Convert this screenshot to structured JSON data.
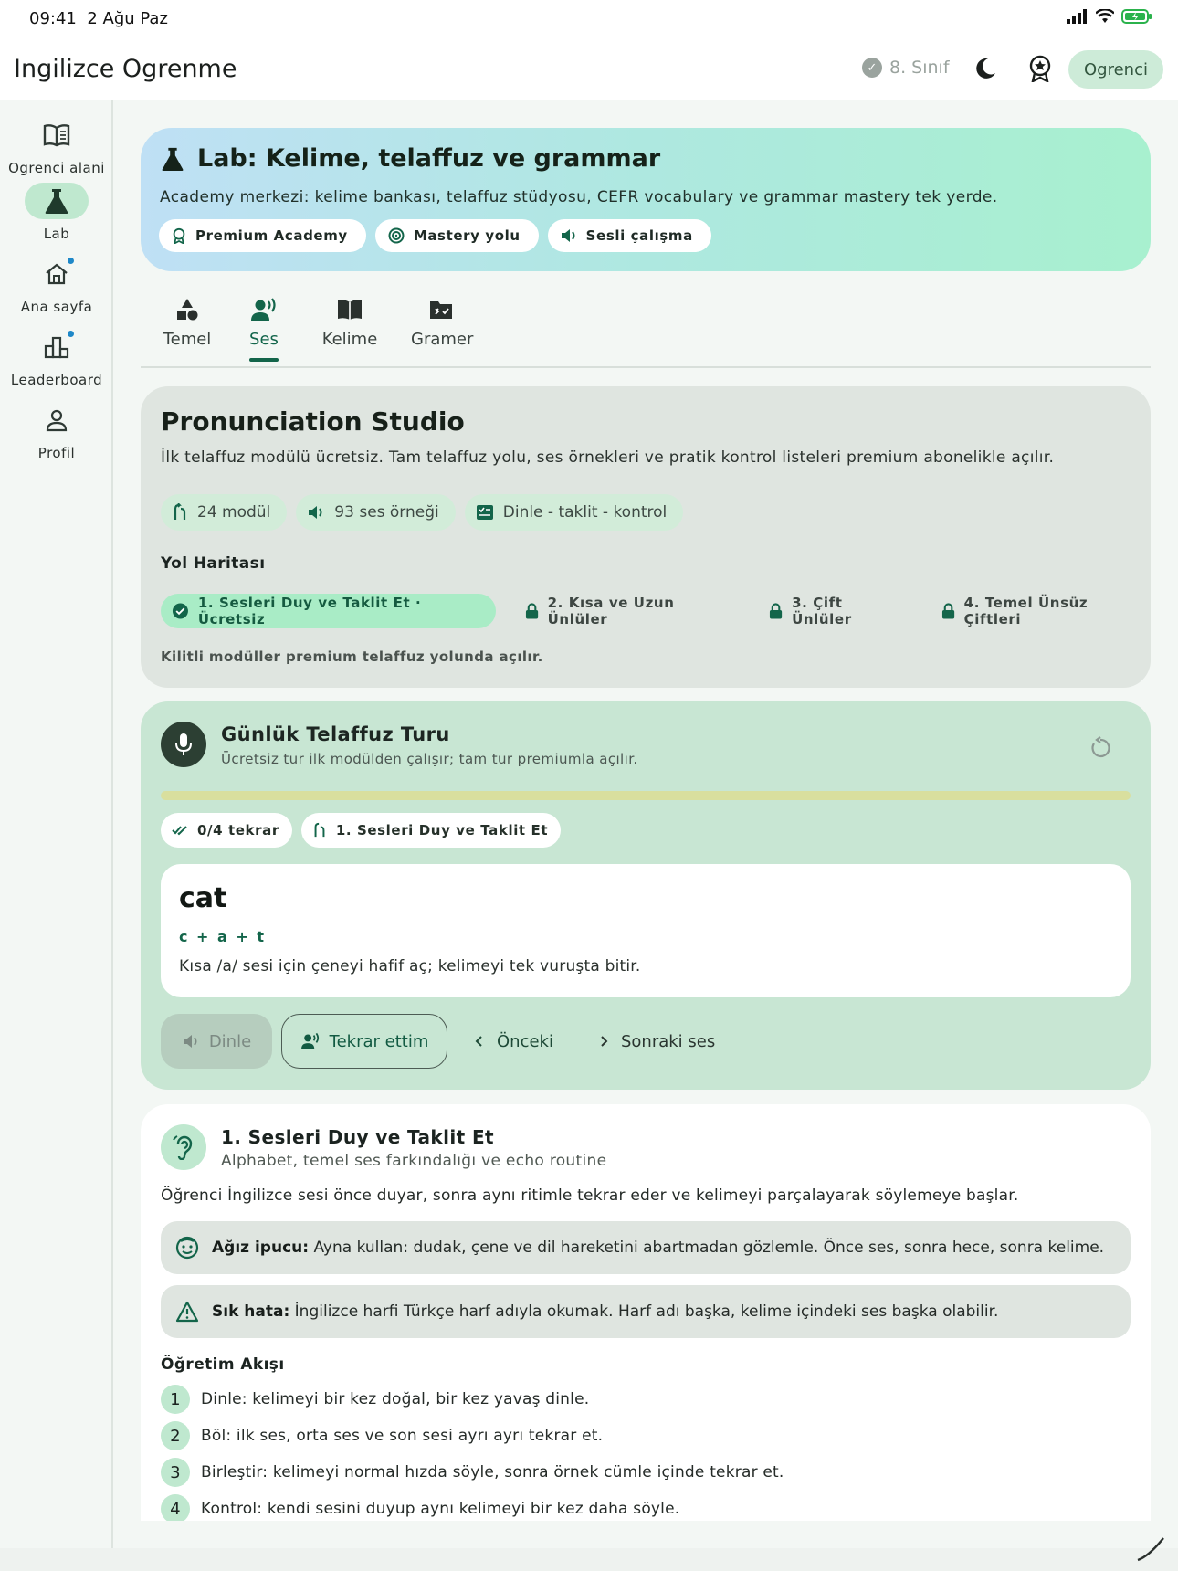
{
  "status_bar": {
    "time": "09:41",
    "date": "2 Ağu Paz"
  },
  "app": {
    "title": "Ingilizce Ogrenme",
    "grade": "8. Sınıf",
    "role": "Ogrenci"
  },
  "sidebar": {
    "items": [
      {
        "label": "Ogrenci alani",
        "icon": "book-icon",
        "active": false
      },
      {
        "label": "Lab",
        "icon": "flask-icon",
        "active": true
      },
      {
        "label": "Ana sayfa",
        "icon": "home-icon",
        "active": false,
        "badge": true
      },
      {
        "label": "Leaderboard",
        "icon": "leaderboard-icon",
        "active": false,
        "badge": true
      },
      {
        "label": "Profil",
        "icon": "person-icon",
        "active": false
      }
    ]
  },
  "hero": {
    "title": "Lab: Kelime, telaffuz ve grammar",
    "description": "Academy merkezi: kelime bankası, telaffuz stüdyosu, CEFR vocabulary ve grammar mastery tek yerde.",
    "chips": [
      "Premium Academy",
      "Mastery yolu",
      "Sesli çalışma"
    ]
  },
  "tabs": [
    {
      "label": "Temel",
      "active": false
    },
    {
      "label": "Ses",
      "active": true
    },
    {
      "label": "Kelime",
      "active": false
    },
    {
      "label": "Gramer",
      "active": false
    }
  ],
  "studio": {
    "title": "Pronunciation Studio",
    "description": "İlk telaffuz modülü ücretsiz. Tam telaffuz yolu, ses örnekleri ve pratik kontrol listeleri premium abonelikle açılır.",
    "stats": [
      "24 modül",
      "93 ses örneği",
      "Dinle - taklit - kontrol"
    ],
    "roadmap_title": "Yol Haritası",
    "roadmap": [
      {
        "label": "1. Sesleri Duy ve Taklit Et · Ücretsiz",
        "state": "done"
      },
      {
        "label": "2. Kısa ve Uzun Ünlüler",
        "state": "locked"
      },
      {
        "label": "3. Çift Ünlüler",
        "state": "locked"
      },
      {
        "label": "4. Temel Ünsüz Çiftleri",
        "state": "locked"
      }
    ],
    "note": "Kilitli modüller premium telaffuz yolunda açılır."
  },
  "daily": {
    "title": "Günlük Telaffuz Turu",
    "subtitle": "Ücretsiz tur ilk modülden çalışır; tam tur premiumla açılır.",
    "progress": 0,
    "repeat_count": "0/4 tekrar",
    "module": "1. Sesleri Duy ve Taklit Et",
    "word": "cat",
    "phonics": "c + a + t",
    "tip": "Kısa /a/ sesi için çeneyi hafif aç; kelimeyi tek vuruşta bitir.",
    "buttons": {
      "listen": "Dinle",
      "repeat": "Tekrar ettim",
      "prev": "Önceki",
      "next": "Sonraki ses"
    }
  },
  "lesson": {
    "title": "1. Sesleri Duy ve Taklit Et",
    "subtitle": "Alphabet, temel ses farkındalığı ve echo routine",
    "description": "Öğrenci İngilizce sesi önce duyar, sonra aynı ritimle tekrar eder ve kelimeyi parçalayarak söylemeye başlar.",
    "mouth_tip_label": "Ağız ipucu:",
    "mouth_tip": "Ayna kullan: dudak, çene ve dil hareketini abartmadan gözlemle. Önce ses, sonra hece, sonra kelime.",
    "mistake_label": "Sık hata:",
    "mistake": "İngilizce harfi Türkçe harf adıyla okumak. Harf adı başka, kelime içindeki ses başka olabilir.",
    "flow_title": "Öğretim Akışı",
    "flow": [
      {
        "num": "1",
        "text": "Dinle: kelimeyi bir kez doğal, bir kez yavaş dinle."
      },
      {
        "num": "2",
        "text": "Böl: ilk ses, orta ses ve son sesi ayrı ayrı tekrar et."
      },
      {
        "num": "3",
        "text": "Birleştir: kelimeyi normal hızda söyle, sonra örnek cümle içinde tekrar et."
      },
      {
        "num": "4",
        "text": "Kontrol: kendi sesini duyup aynı kelimeyi bir kez daha söyle."
      }
    ]
  },
  "colors": {
    "accent": "#13654a",
    "accent_light": "#bfe8cf",
    "card_gray": "#dfe5e0",
    "card_green": "#c8e6d3"
  }
}
